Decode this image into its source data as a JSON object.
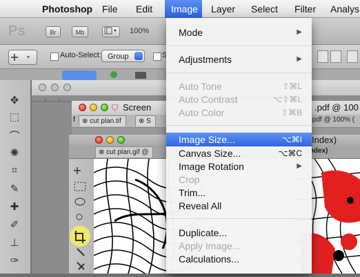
{
  "menubar": {
    "app_name": "Photoshop",
    "items": [
      "File",
      "Edit",
      "Image",
      "Layer",
      "Select",
      "Filter",
      "Analys"
    ]
  },
  "toolbar": {
    "ps_logo": "Ps",
    "br_label": "Br",
    "mb_label": "Mb",
    "zoom": "100%"
  },
  "options": {
    "auto_select_label": "Auto-Select:",
    "auto_select_value": "Group",
    "second_checkbox_fragment": "S"
  },
  "windows": {
    "screenshot_title_partial": "Screen",
    "screenshot_title_right": ".pdf @ 100",
    "tabs_row1": [
      "cut plan.tif",
      "S"
    ],
    "tab_right_row1": ".pdf @ 100% (",
    "tab_row2": "cut plan.gif @",
    "tab_right_row2": "Index)",
    "index_title": "Index)"
  },
  "image_menu": {
    "items": [
      {
        "label": "Mode",
        "submenu": true,
        "enabled": true
      },
      {
        "label": "Adjustments",
        "submenu": true,
        "enabled": true
      },
      {
        "label": "Auto Tone",
        "shortcut": "⇧⌘L",
        "enabled": false
      },
      {
        "label": "Auto Contrast",
        "shortcut": "⌥⇧⌘L",
        "enabled": false
      },
      {
        "label": "Auto Color",
        "shortcut": "⇧⌘B",
        "enabled": false
      },
      {
        "label": "Image Size...",
        "shortcut": "⌥⌘I",
        "enabled": true,
        "highlighted": true
      },
      {
        "label": "Canvas Size...",
        "shortcut": "⌥⌘C",
        "enabled": true
      },
      {
        "label": "Image Rotation",
        "submenu": true,
        "enabled": true
      },
      {
        "label": "Crop",
        "enabled": false
      },
      {
        "label": "Trim...",
        "enabled": true
      },
      {
        "label": "Reveal All",
        "enabled": true
      },
      {
        "label": "Duplicate...",
        "enabled": true
      },
      {
        "label": "Apply Image...",
        "enabled": false
      },
      {
        "label": "Calculations...",
        "enabled": true
      }
    ]
  },
  "colors": {
    "menu_highlight": "#3b72e6",
    "artwork_red": "#e32020",
    "crop_tool_highlight": "#eeea6a"
  }
}
